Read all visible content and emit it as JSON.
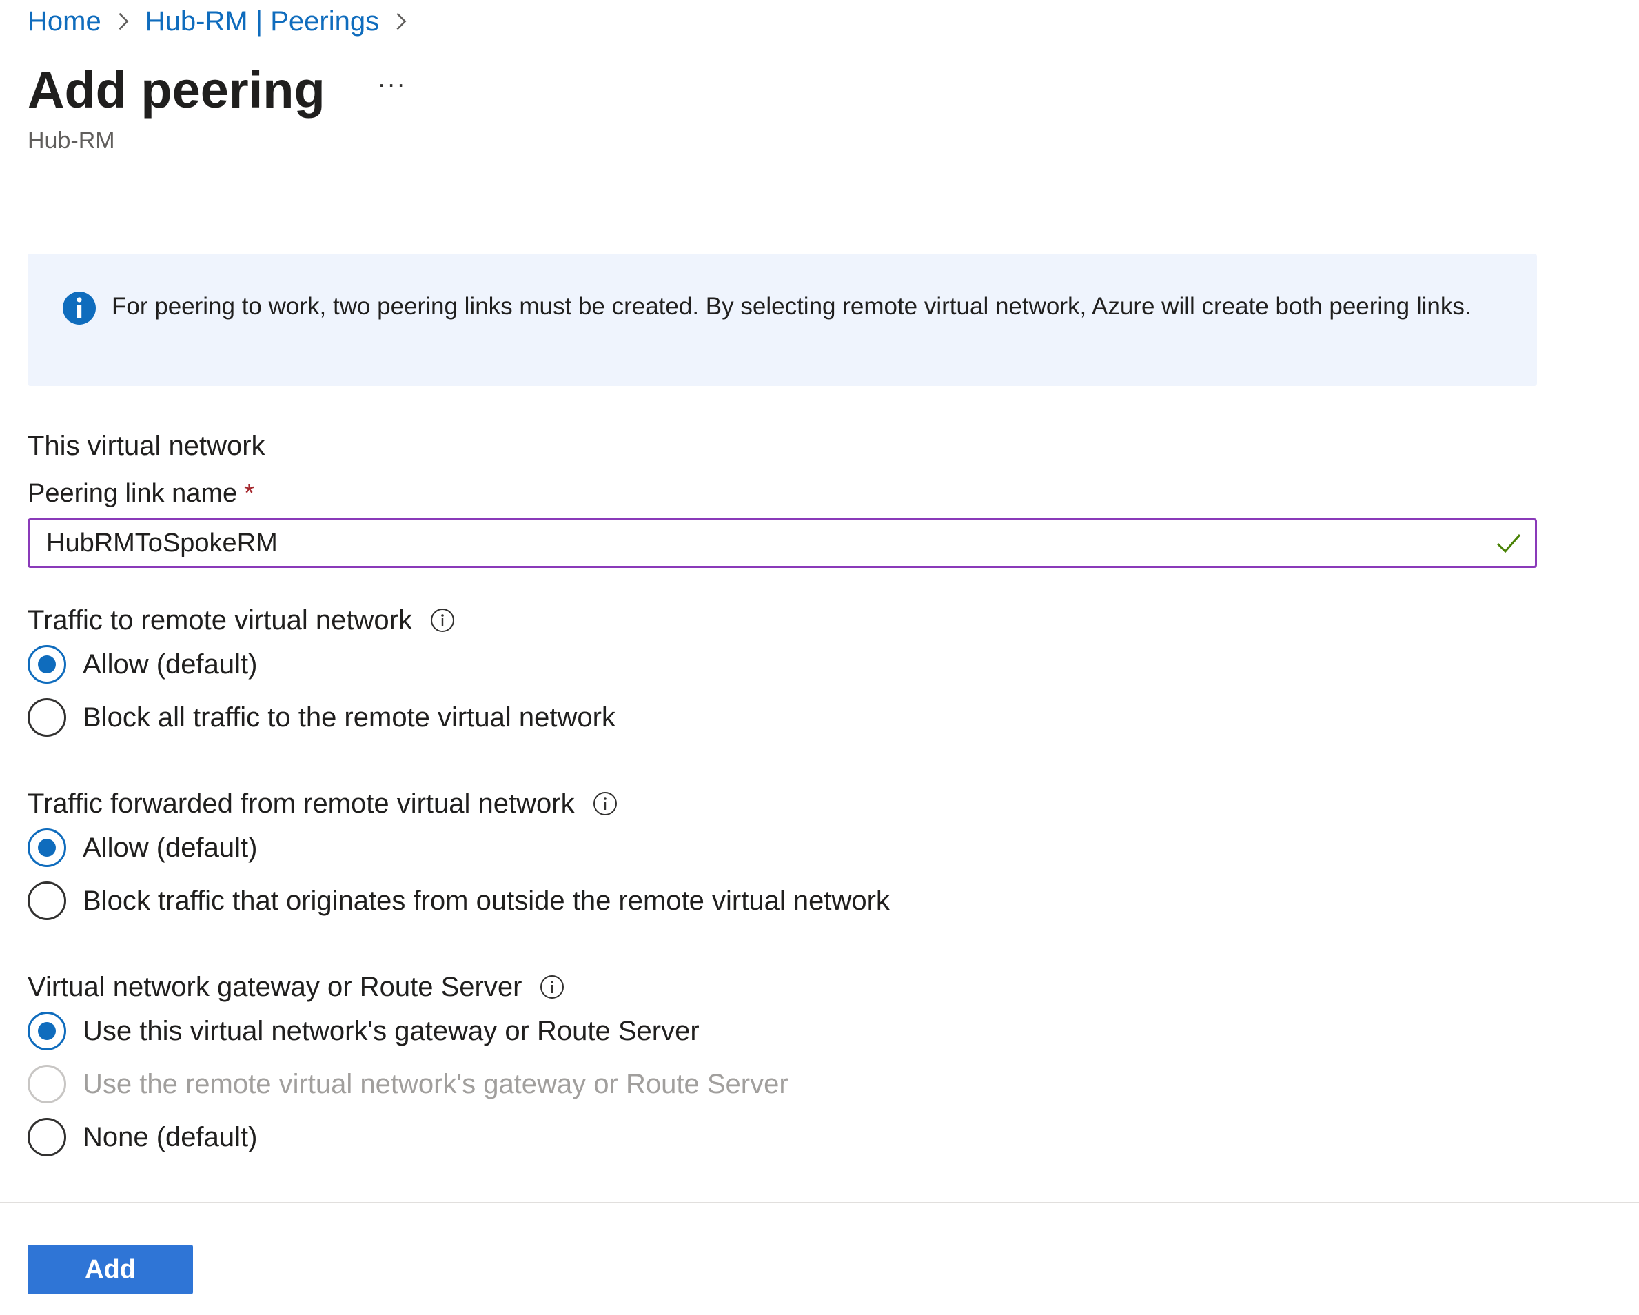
{
  "breadcrumb": {
    "items": [
      "Home",
      "Hub-RM | Peerings"
    ]
  },
  "header": {
    "title": "Add peering",
    "more_label": "···",
    "subtitle": "Hub-RM"
  },
  "info": {
    "icon": "info-icon",
    "text": "For peering to work, two peering links must be created. By selecting remote virtual network, Azure will create both peering links."
  },
  "form": {
    "section_heading": "This virtual network",
    "peering_link": {
      "label": "Peering link name",
      "required_marker": "*",
      "value": "HubRMToSpokeRM"
    },
    "traffic_to_remote": {
      "label": "Traffic to remote virtual network",
      "options": [
        {
          "label": "Allow (default)",
          "checked": true,
          "disabled": false
        },
        {
          "label": "Block all traffic to the remote virtual network",
          "checked": false,
          "disabled": false
        }
      ]
    },
    "traffic_forwarded": {
      "label": "Traffic forwarded from remote virtual network",
      "options": [
        {
          "label": "Allow (default)",
          "checked": true,
          "disabled": false
        },
        {
          "label": "Block traffic that originates from outside the remote virtual network",
          "checked": false,
          "disabled": false
        }
      ]
    },
    "gateway": {
      "label": "Virtual network gateway or Route Server",
      "options": [
        {
          "label": "Use this virtual network's gateway or Route Server",
          "checked": true,
          "disabled": false
        },
        {
          "label": "Use the remote virtual network's gateway or Route Server",
          "checked": false,
          "disabled": true
        },
        {
          "label": "None (default)",
          "checked": false,
          "disabled": false
        }
      ]
    }
  },
  "footer": {
    "add_label": "Add"
  },
  "colors": {
    "accent": "#0f6cbd",
    "button": "#2f75d6",
    "info_background": "#eff4fd",
    "input_border": "#8a3ab9",
    "valid_check": "#498205",
    "required": "#a4262c"
  }
}
